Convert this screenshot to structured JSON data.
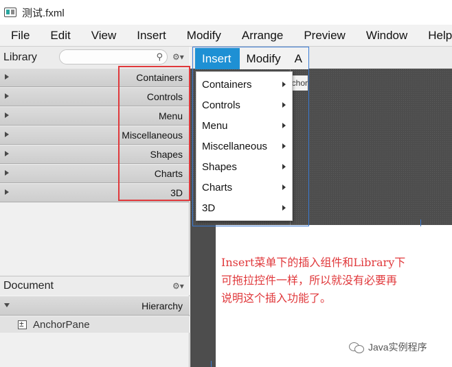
{
  "window": {
    "title": "测试.fxml"
  },
  "menubar": [
    "File",
    "Edit",
    "View",
    "Insert",
    "Modify",
    "Arrange",
    "Preview",
    "Window",
    "Help"
  ],
  "library": {
    "title": "Library",
    "search_icon": "search-icon",
    "categories": [
      "Containers",
      "Controls",
      "Menu",
      "Miscellaneous",
      "Shapes",
      "Charts",
      "3D"
    ]
  },
  "document": {
    "title": "Document",
    "hierarchy_label": "Hierarchy",
    "tree_root": "AnchorPane"
  },
  "canvas": {
    "stub_label": "nchor"
  },
  "popup": {
    "tabs": [
      "Insert",
      "Modify",
      "A"
    ],
    "items": [
      "Containers",
      "Controls",
      "Menu",
      "Miscellaneous",
      "Shapes",
      "Charts",
      "3D"
    ]
  },
  "annotation": {
    "lines": [
      "Insert菜单下的插入组件和Library下",
      "可拖拉控件一样，所以就没有必要再",
      "说明这个插入功能了。"
    ],
    "color": "#e0383b"
  },
  "watermark": {
    "text": "Java实例程序"
  },
  "colors": {
    "accent": "#1e90d4",
    "highlight": "#e0383b",
    "selection": "#3a7bd5"
  }
}
